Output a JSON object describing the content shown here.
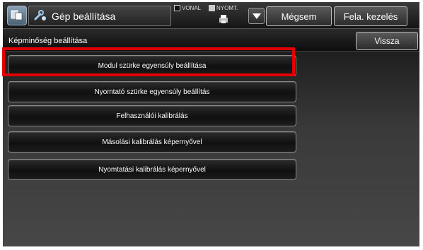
{
  "header": {
    "title": "Gép beállítása",
    "indicators": {
      "vonal": "VONAL",
      "nyomt": "NYOMT."
    },
    "cancel_label": "Mégsem",
    "upper_label": "Fela. kezelés"
  },
  "subheader": {
    "title": "Képminőség beállítása",
    "back_label": "Vissza"
  },
  "menu": {
    "items": [
      {
        "label": "Modul szürke egyensúly beállítása",
        "highlighted": true
      },
      {
        "label": "Nyomtató szürke egyensúly beállítás",
        "highlighted": false
      },
      {
        "label": "Felhasználói kalibrálás",
        "highlighted": false
      },
      {
        "label": "Másolási kalibrálás képernyővel",
        "highlighted": false
      },
      {
        "label": "Nyomtatási kalibrálás képernyővel",
        "highlighted": false
      }
    ]
  },
  "colors": {
    "highlight": "#e00000",
    "background": "#000000"
  }
}
